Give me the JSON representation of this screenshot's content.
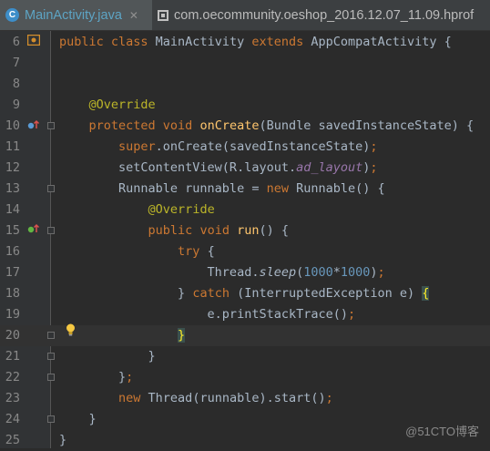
{
  "tabs": [
    {
      "title": "MainActivity.java",
      "icon": "java-class-icon",
      "active": true
    },
    {
      "title": "com.oecommunity.oeshop_2016.12.07_11.09.hprof",
      "icon": "hprof-file-icon",
      "active": false
    }
  ],
  "lines": [
    {
      "n": "6",
      "tokens": [
        [
          "kw",
          "public class "
        ],
        [
          "p",
          "MainActivity "
        ],
        [
          "kw",
          "extends "
        ],
        [
          "p",
          "AppCompatActivity {"
        ]
      ]
    },
    {
      "n": "7",
      "tokens": []
    },
    {
      "n": "8",
      "tokens": []
    },
    {
      "n": "9",
      "tokens": [
        [
          "p",
          "    "
        ],
        [
          "ann",
          "@Override"
        ]
      ]
    },
    {
      "n": "10",
      "tokens": [
        [
          "p",
          "    "
        ],
        [
          "kw",
          "protected void "
        ],
        [
          "fn",
          "onCreate"
        ],
        [
          "p",
          "(Bundle savedInstanceState) {"
        ]
      ]
    },
    {
      "n": "11",
      "tokens": [
        [
          "p",
          "        "
        ],
        [
          "kw",
          "super"
        ],
        [
          "p",
          ".onCreate(savedInstanceState)"
        ],
        [
          "kw",
          ";"
        ]
      ]
    },
    {
      "n": "12",
      "tokens": [
        [
          "p",
          "        setContentView(R.layout."
        ],
        [
          "field",
          "ad_layout"
        ],
        [
          "p",
          ")"
        ],
        [
          "kw",
          ";"
        ]
      ]
    },
    {
      "n": "13",
      "tokens": [
        [
          "p",
          "        Runnable runnable = "
        ],
        [
          "kw",
          "new "
        ],
        [
          "p",
          "Runnable() {"
        ]
      ]
    },
    {
      "n": "14",
      "tokens": [
        [
          "p",
          "            "
        ],
        [
          "ann",
          "@Override"
        ]
      ]
    },
    {
      "n": "15",
      "tokens": [
        [
          "p",
          "            "
        ],
        [
          "kw",
          "public void "
        ],
        [
          "fn",
          "run"
        ],
        [
          "p",
          "() {"
        ]
      ]
    },
    {
      "n": "16",
      "tokens": [
        [
          "p",
          "                "
        ],
        [
          "kw",
          "try "
        ],
        [
          "p",
          "{"
        ]
      ]
    },
    {
      "n": "17",
      "tokens": [
        [
          "p",
          "                    Thread."
        ],
        [
          "static",
          "sleep"
        ],
        [
          "p",
          "("
        ],
        [
          "num",
          "1000"
        ],
        [
          "p",
          "*"
        ],
        [
          "num",
          "1000"
        ],
        [
          "p",
          ")"
        ],
        [
          "kw",
          ";"
        ]
      ]
    },
    {
      "n": "18",
      "tokens": [
        [
          "p",
          "                } "
        ],
        [
          "kw",
          "catch "
        ],
        [
          "p",
          "(InterruptedException e) "
        ],
        [
          "hl",
          "{"
        ]
      ]
    },
    {
      "n": "19",
      "tokens": [
        [
          "p",
          "                    e.printStackTrace()"
        ],
        [
          "kw",
          ";"
        ]
      ]
    },
    {
      "n": "20",
      "tokens": [
        [
          "p",
          "                "
        ],
        [
          "hl",
          "}"
        ]
      ]
    },
    {
      "n": "21",
      "tokens": [
        [
          "p",
          "            }"
        ]
      ]
    },
    {
      "n": "22",
      "tokens": [
        [
          "p",
          "        }"
        ],
        [
          "kw",
          ";"
        ]
      ]
    },
    {
      "n": "23",
      "tokens": [
        [
          "p",
          "        "
        ],
        [
          "kw",
          "new "
        ],
        [
          "p",
          "Thread(runnable).start()"
        ],
        [
          "kw",
          ";"
        ]
      ]
    },
    {
      "n": "24",
      "tokens": [
        [
          "p",
          "    }"
        ]
      ]
    },
    {
      "n": "25",
      "tokens": [
        [
          "p",
          "}"
        ]
      ]
    }
  ],
  "gutter_markers": [
    {
      "line": "6",
      "icon": "android-activity-icon"
    },
    {
      "line": "10",
      "icon": "override-method-icon"
    },
    {
      "line": "15",
      "icon": "implement-method-icon"
    },
    {
      "line": "20",
      "icon": "lightbulb-intention-icon"
    }
  ],
  "watermark": "@51CTO博客",
  "colors": {
    "background": "#2b2b2b",
    "gutter": "#313335",
    "keyword": "#cc7832",
    "annotation": "#bbb529",
    "method": "#ffc66d",
    "number": "#6897bb",
    "field": "#9876aa",
    "text": "#a9b7c6"
  }
}
